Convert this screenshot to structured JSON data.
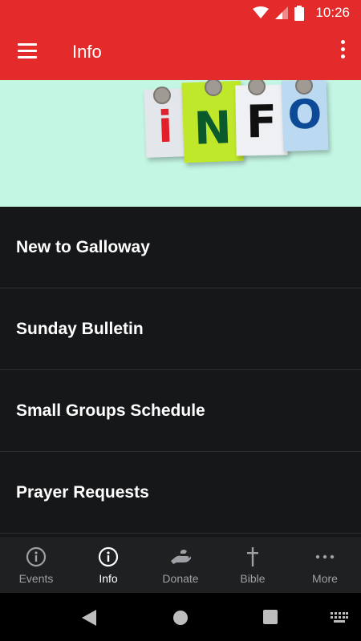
{
  "status": {
    "time": "10:26"
  },
  "app_bar": {
    "title": "Info"
  },
  "banner": {
    "letters": [
      "i",
      "N",
      "F",
      "O"
    ]
  },
  "menu_items": [
    {
      "label": "New to Galloway"
    },
    {
      "label": "Sunday Bulletin"
    },
    {
      "label": "Small Groups Schedule"
    },
    {
      "label": "Prayer Requests"
    }
  ],
  "tabs": [
    {
      "label": "Events",
      "icon": "info-circle-icon",
      "active": false
    },
    {
      "label": "Info",
      "icon": "info-circle-icon",
      "active": true
    },
    {
      "label": "Donate",
      "icon": "donate-hand-icon",
      "active": false
    },
    {
      "label": "Bible",
      "icon": "cross-icon",
      "active": false
    },
    {
      "label": "More",
      "icon": "more-dots-icon",
      "active": false
    }
  ],
  "colors": {
    "accent": "#e32b2b",
    "background": "#161719",
    "banner_bg": "#c4f6e4",
    "tab_bar": "#1f2022"
  }
}
